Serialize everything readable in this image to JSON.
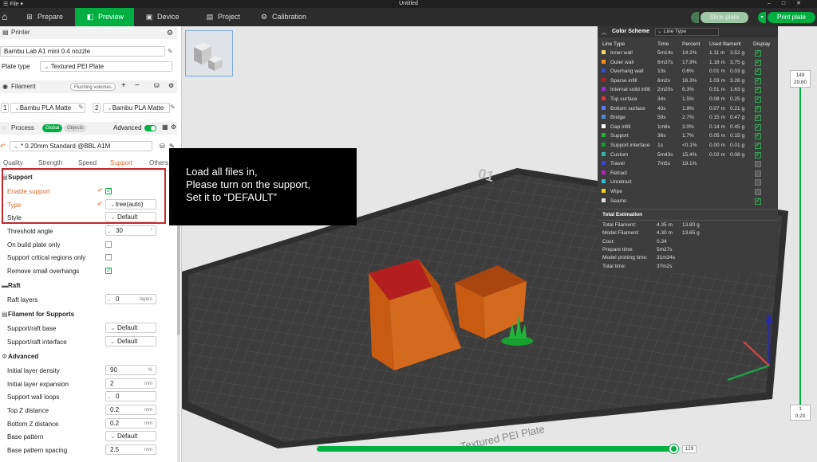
{
  "window": {
    "file_menu": "File",
    "title": "Untitled"
  },
  "nav": {
    "prepare": "Prepare",
    "preview": "Preview",
    "device": "Device",
    "project": "Project",
    "calibration": "Calibration",
    "slice_plate": "Slice plate",
    "print_plate": "Print plate"
  },
  "left": {
    "printer_title": "Printer",
    "printer_name": "Bambu Lab A1 mini 0.4 nozzle",
    "plate_type_label": "Plate type",
    "plate_type_value": "Textured PEI Plate",
    "filament_title": "Filament",
    "flushing_volumes": "Flushing volumes",
    "filament_slots": [
      {
        "index": "1",
        "name": "Bambu PLA Matte",
        "color": "#ffffff"
      },
      {
        "index": "2",
        "name": "Bambu PLA Matte",
        "color": "#ffffff"
      }
    ],
    "process_title": "Process",
    "process_global": "Global",
    "process_objects": "Objects",
    "advanced_label": "Advanced",
    "process_profile": "* 0.20mm Standard @BBL A1M",
    "tabs": [
      "Quality",
      "Strength",
      "Speed",
      "Support",
      "Others"
    ],
    "support_group": "Support",
    "enable_support": "Enable support",
    "type_label": "Type",
    "type_value": "tree(auto)",
    "style_label": "Style",
    "style_value": "Default",
    "threshold_angle_label": "Threshold angle",
    "threshold_angle_value": "30",
    "threshold_angle_unit": "°",
    "on_build_plate_only": "On build plate only",
    "support_critical_regions_only": "Support critical regions only",
    "remove_small_overhangs": "Remove small overhangs",
    "raft_group": "Raft",
    "raft_layers_label": "Raft layers",
    "raft_layers_value": "0",
    "raft_layers_unit": "layers",
    "filament_supports_group": "Filament for Supports",
    "support_raft_base_label": "Support/raft base",
    "support_raft_base_value": "Default",
    "support_raft_interface_label": "Support/raft interface",
    "support_raft_interface_value": "Default",
    "advanced_group": "Advanced",
    "initial_layer_density_label": "Initial layer density",
    "initial_layer_density_value": "90",
    "initial_layer_density_unit": "%",
    "initial_layer_expansion_label": "Initial layer expansion",
    "initial_layer_expansion_value": "2",
    "initial_layer_expansion_unit": "mm",
    "support_wall_loops_label": "Support wall loops",
    "support_wall_loops_value": "0",
    "top_z_label": "Top Z distance",
    "top_z_value": "0.2",
    "top_z_unit": "mm",
    "bottom_z_label": "Bottom Z distance",
    "bottom_z_value": "0.2",
    "bottom_z_unit": "mm",
    "base_pattern_label": "Base pattern",
    "base_pattern_value": "Default",
    "base_pattern_spacing_label": "Base pattern spacing",
    "base_pattern_spacing_value": "2.5",
    "base_pattern_spacing_unit": "mm"
  },
  "note": {
    "line1": "Load all files in,",
    "line2": "Please turn on the support,",
    "line3": "Set it to “DEFAULT”"
  },
  "viewport": {
    "plate_number": "01",
    "plate_text": "Textured PEI Plate",
    "layer_top": "149",
    "layer_top_height": "29.80",
    "layer_bottom": "1",
    "layer_bottom_height": "0.20",
    "move_position": "129"
  },
  "legend": {
    "title": "Color Scheme",
    "selector": "Line Type",
    "columns": {
      "type": "Line Type",
      "time": "Time",
      "percent": "Percent",
      "used": "Used filament",
      "display": "Display"
    },
    "rows": [
      {
        "name": "Inner wall",
        "color": "#f5d76e",
        "time": "5m14s",
        "percent": "14.2%",
        "len": "1.11 m",
        "g": "3.52 g",
        "display": true
      },
      {
        "name": "Outer wall",
        "color": "#ff8c1a",
        "time": "6m37s",
        "percent": "17.9%",
        "len": "1.18 m",
        "g": "3.75 g",
        "display": true
      },
      {
        "name": "Overhang wall",
        "color": "#2f4bd6",
        "time": "13s",
        "percent": "0.6%",
        "len": "0.01 m",
        "g": "0.03 g",
        "display": true
      },
      {
        "name": "Sparse infill",
        "color": "#b3201f",
        "time": "6m2s",
        "percent": "16.3%",
        "len": "1.03 m",
        "g": "3.26 g",
        "display": true
      },
      {
        "name": "Internal solid infill",
        "color": "#9e2ad1",
        "time": "2m20s",
        "percent": "6.3%",
        "len": "0.51 m",
        "g": "1.63 g",
        "display": true
      },
      {
        "name": "Top surface",
        "color": "#e8333a",
        "time": "34s",
        "percent": "1.5%",
        "len": "0.08 m",
        "g": "0.25 g",
        "display": true
      },
      {
        "name": "Bottom surface",
        "color": "#5a7cf0",
        "time": "40s",
        "percent": "1.8%",
        "len": "0.07 m",
        "g": "0.21 g",
        "display": true
      },
      {
        "name": "Bridge",
        "color": "#4a90d9",
        "time": "59s",
        "percent": "2.7%",
        "len": "0.15 m",
        "g": "0.47 g",
        "display": true
      },
      {
        "name": "Gap infill",
        "color": "#ffffff",
        "time": "1m6s",
        "percent": "3.0%",
        "len": "0.14 m",
        "g": "0.45 g",
        "display": true
      },
      {
        "name": "Support",
        "color": "#1fb539",
        "time": "36s",
        "percent": "1.7%",
        "len": "0.05 m",
        "g": "0.15 g",
        "display": true
      },
      {
        "name": "Support interface",
        "color": "#16a02b",
        "time": "1s",
        "percent": "<0.1%",
        "len": "0.00 m",
        "g": "0.01 g",
        "display": true
      },
      {
        "name": "Custom",
        "color": "#2fb8a4",
        "time": "5m43s",
        "percent": "15.4%",
        "len": "0.02 m",
        "g": "0.08 g",
        "display": true
      },
      {
        "name": "Travel",
        "color": "#3d43e0",
        "time": "7m5s",
        "percent": "19.1%",
        "len": "",
        "g": "",
        "display": false
      },
      {
        "name": "Retract",
        "color": "#c21fc2",
        "time": "",
        "percent": "",
        "len": "",
        "g": "",
        "display": false
      },
      {
        "name": "Unretract",
        "color": "#2bbfd6",
        "time": "",
        "percent": "",
        "len": "",
        "g": "",
        "display": false
      },
      {
        "name": "Wipe",
        "color": "#f0d21a",
        "time": "",
        "percent": "",
        "len": "",
        "g": "",
        "display": false
      },
      {
        "name": "Seams",
        "color": "#dddddd",
        "time": "",
        "percent": "",
        "len": "",
        "g": "",
        "display": true
      }
    ],
    "estimation_title": "Total Estimation",
    "estimation": [
      {
        "label": "Total Filament:",
        "a": "4.35 m",
        "b": "13.80 g"
      },
      {
        "label": "Model Filament:",
        "a": "4.30 m",
        "b": "13.65 g"
      },
      {
        "label": "Cost:",
        "a": "0.34",
        "b": ""
      },
      {
        "label": "Prepare time:",
        "a": "5m27s",
        "b": ""
      },
      {
        "label": "Model printing time:",
        "a": "31m34s",
        "b": ""
      },
      {
        "label": "Total time:",
        "a": "37m2s",
        "b": ""
      }
    ]
  },
  "colors": {
    "accent": "#00ae42",
    "orange": "#e26c2d",
    "model": "#c85a12",
    "highlight": "#c1272d"
  }
}
